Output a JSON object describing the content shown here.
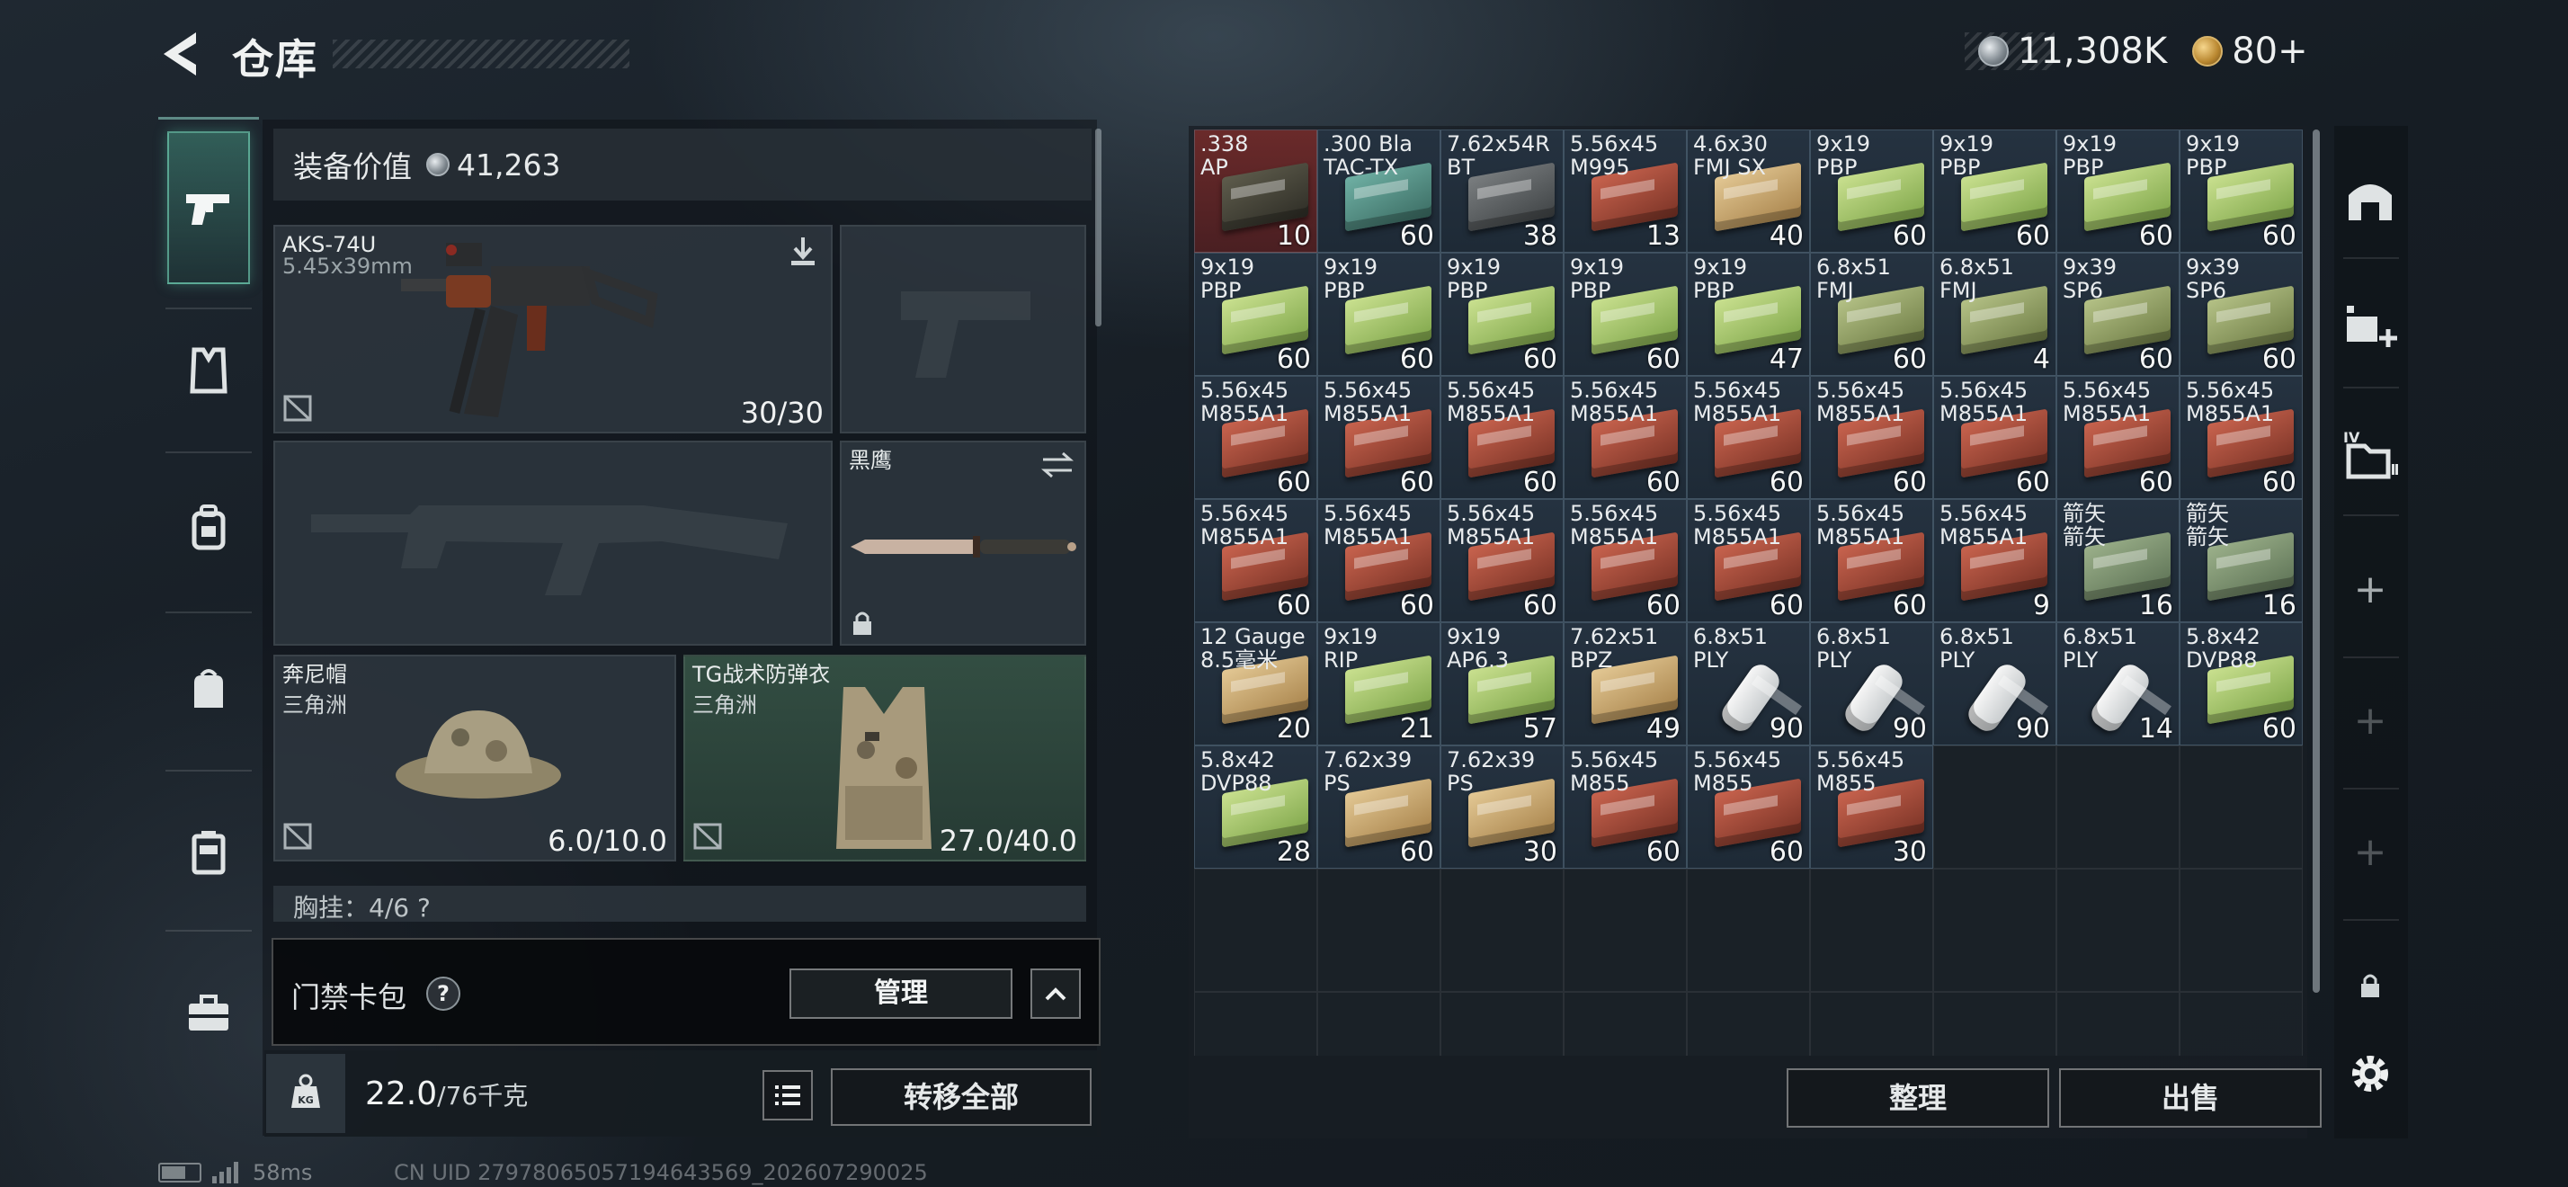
{
  "header": {
    "title": "仓库",
    "silver": "11,308K",
    "gold": "80+"
  },
  "nav": {
    "items": [
      "gun-icon",
      "vest-icon",
      "backpack-icon",
      "pouch-icon",
      "rig-icon",
      "toolbox-icon"
    ],
    "selected": "gun-icon"
  },
  "equipment": {
    "value_label": "装备价值",
    "value": "41,263",
    "primary": {
      "name": "AKS-74U",
      "caliber": "5.45x39mm",
      "ammo": "30/30"
    },
    "melee": {
      "name": "黑鹰"
    },
    "helmet": {
      "name": "奔尼帽",
      "brand": "三角洲",
      "durability": "6.0/10.0"
    },
    "armor": {
      "name": "TG战术防弹衣",
      "brand": "三角洲",
      "durability": "27.0/40.0"
    },
    "rig_label": "胸挂：4/6 ?"
  },
  "keycard": {
    "label": "门禁卡包",
    "help": "?",
    "manage_label": "管理"
  },
  "weight": {
    "current": "22.0",
    "max": "/76千克",
    "transfer_all": "转移全部"
  },
  "stash": {
    "items": [
      {
        "name": ".338\nAP",
        "count": "10",
        "style": "dark",
        "bg": "red"
      },
      {
        "name": ".300 Bla\nTAC-TX",
        "count": "60",
        "style": "teal"
      },
      {
        "name": "7.62x54R\nBT",
        "count": "38",
        "style": "gray"
      },
      {
        "name": "5.56x45\nM995",
        "count": "13",
        "style": "red"
      },
      {
        "name": "4.6x30\nFMJ SX",
        "count": "40",
        "style": "tan"
      },
      {
        "name": "9x19\nPBP",
        "count": "60",
        "style": "green"
      },
      {
        "name": "9x19\nPBP",
        "count": "60",
        "style": "green"
      },
      {
        "name": "9x19\nPBP",
        "count": "60",
        "style": "green"
      },
      {
        "name": "9x19\nPBP",
        "count": "60",
        "style": "green"
      },
      {
        "name": "9x19\nPBP",
        "count": "60",
        "style": "green"
      },
      {
        "name": "9x19\nPBP",
        "count": "60",
        "style": "green"
      },
      {
        "name": "9x19\nPBP",
        "count": "60",
        "style": "green"
      },
      {
        "name": "9x19\nPBP",
        "count": "60",
        "style": "green"
      },
      {
        "name": "9x19\nPBP",
        "count": "47",
        "style": "green"
      },
      {
        "name": "6.8x51\nFMJ",
        "count": "60",
        "style": "olive"
      },
      {
        "name": "6.8x51\nFMJ",
        "count": "4",
        "style": "olive"
      },
      {
        "name": "9x39\nSP6",
        "count": "60",
        "style": "olive"
      },
      {
        "name": "9x39\nSP6",
        "count": "60",
        "style": "olive"
      },
      {
        "name": "5.56x45\nM855A1",
        "count": "60",
        "style": "red"
      },
      {
        "name": "5.56x45\nM855A1",
        "count": "60",
        "style": "red"
      },
      {
        "name": "5.56x45\nM855A1",
        "count": "60",
        "style": "red"
      },
      {
        "name": "5.56x45\nM855A1",
        "count": "60",
        "style": "red"
      },
      {
        "name": "5.56x45\nM855A1",
        "count": "60",
        "style": "red"
      },
      {
        "name": "5.56x45\nM855A1",
        "count": "60",
        "style": "red"
      },
      {
        "name": "5.56x45\nM855A1",
        "count": "60",
        "style": "red"
      },
      {
        "name": "5.56x45\nM855A1",
        "count": "60",
        "style": "red"
      },
      {
        "name": "5.56x45\nM855A1",
        "count": "60",
        "style": "red"
      },
      {
        "name": "5.56x45\nM855A1",
        "count": "60",
        "style": "red"
      },
      {
        "name": "5.56x45\nM855A1",
        "count": "60",
        "style": "red"
      },
      {
        "name": "5.56x45\nM855A1",
        "count": "60",
        "style": "red"
      },
      {
        "name": "5.56x45\nM855A1",
        "count": "60",
        "style": "red"
      },
      {
        "name": "5.56x45\nM855A1",
        "count": "60",
        "style": "red"
      },
      {
        "name": "5.56x45\nM855A1",
        "count": "60",
        "style": "red"
      },
      {
        "name": "5.56x45\nM855A1",
        "count": "9",
        "style": "red"
      },
      {
        "name": "箭矢\n箭矢",
        "count": "16",
        "style": "mil"
      },
      {
        "name": "箭矢\n箭矢",
        "count": "16",
        "style": "mil"
      },
      {
        "name": "12 Gauge\n8.5毫米",
        "count": "20",
        "style": "tan"
      },
      {
        "name": "9x19\nRIP",
        "count": "21",
        "style": "green"
      },
      {
        "name": "9x19\nAP6.3",
        "count": "57",
        "style": "green"
      },
      {
        "name": "7.62x51\nBPZ",
        "count": "49",
        "style": "tan"
      },
      {
        "name": "6.8x51\nPLY",
        "count": "90",
        "style": "vial"
      },
      {
        "name": "6.8x51\nPLY",
        "count": "90",
        "style": "vial"
      },
      {
        "name": "6.8x51\nPLY",
        "count": "90",
        "style": "vial"
      },
      {
        "name": "6.8x51\nPLY",
        "count": "14",
        "style": "vial"
      },
      {
        "name": "5.8x42\nDVP88",
        "count": "60",
        "style": "green"
      },
      {
        "name": "5.8x42\nDVP88",
        "count": "28",
        "style": "green"
      },
      {
        "name": "7.62x39\nPS",
        "count": "60",
        "style": "tan"
      },
      {
        "name": "7.62x39\nPS",
        "count": "30",
        "style": "tan"
      },
      {
        "name": "5.56x45\nM855",
        "count": "60",
        "style": "red"
      },
      {
        "name": "5.56x45\nM855",
        "count": "60",
        "style": "red"
      },
      {
        "name": "5.56x45\nM855",
        "count": "30",
        "style": "red"
      }
    ],
    "sort_label": "整理",
    "sell_label": "出售"
  },
  "status": {
    "ping": "58ms",
    "uid": "CN UID 2797806505719464356​9_202607290025"
  }
}
